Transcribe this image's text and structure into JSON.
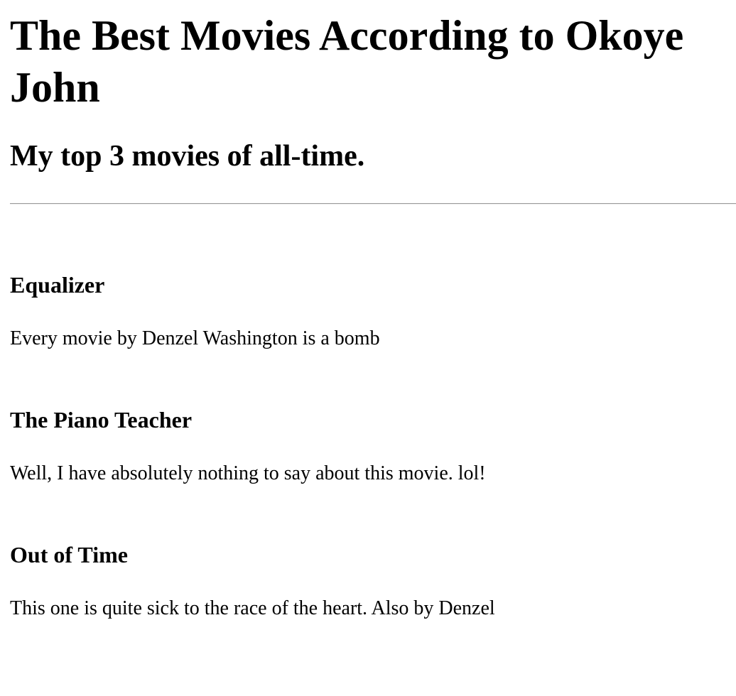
{
  "page": {
    "title": "The Best Movies According to Okoye John",
    "subtitle": "My top 3 movies of all-time."
  },
  "movies": [
    {
      "title": "Equalizer",
      "description": "Every movie by Denzel Washington is a bomb"
    },
    {
      "title": "The Piano Teacher",
      "description": "Well, I have absolutely nothing to say about this movie. lol!"
    },
    {
      "title": "Out of Time",
      "description": "This one is quite sick to the race of the heart. Also by Denzel"
    }
  ]
}
